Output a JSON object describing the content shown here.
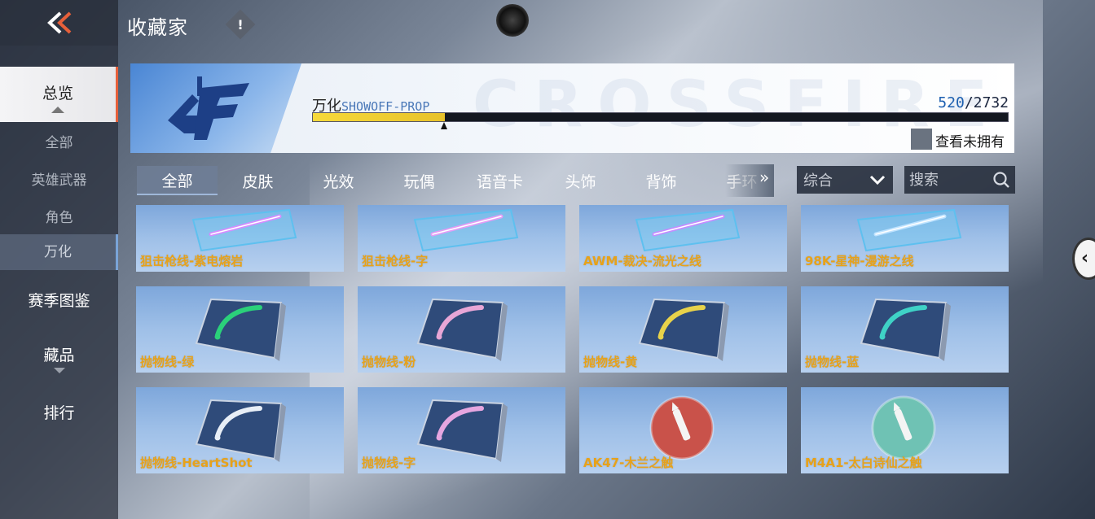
{
  "header": {
    "title": "收藏家",
    "info_glyph": "!"
  },
  "sidebar": {
    "items": [
      {
        "label": "总览"
      },
      {
        "label": "全部"
      },
      {
        "label": "英雄武器"
      },
      {
        "label": "角色"
      },
      {
        "label": "万化"
      },
      {
        "label": "赛季图鉴"
      },
      {
        "label": "藏品"
      },
      {
        "label": "排行"
      }
    ]
  },
  "banner": {
    "name": "万化",
    "sub": "SHOWOFF-PROP",
    "watermark": "CROSSFIRE",
    "count_current": "520",
    "count_total": "/2732",
    "progress_fraction": 0.19,
    "toggle_label": "查看未拥有"
  },
  "tabs": [
    {
      "label": "全部"
    },
    {
      "label": "皮肤"
    },
    {
      "label": "光效"
    },
    {
      "label": "玩偶"
    },
    {
      "label": "语音卡"
    },
    {
      "label": "头饰"
    },
    {
      "label": "背饰"
    },
    {
      "label": "手环"
    }
  ],
  "tabs_more": "»",
  "sort": {
    "value": "综合"
  },
  "search": {
    "placeholder": "搜索"
  },
  "items": [
    {
      "label": "狙击枪线-紫电熔岩",
      "kind": "laser",
      "color": "#d58cff"
    },
    {
      "label": "狙击枪线-字",
      "kind": "laser",
      "color": "#e39cf5"
    },
    {
      "label": "AWM-裁决-流光之线",
      "kind": "laser",
      "color": "#c48cff"
    },
    {
      "label": "98K-星神-漫游之线",
      "kind": "laser",
      "color": "#bfe3ff"
    },
    {
      "label": "抛物线-绿",
      "kind": "arc",
      "color": "#2bd17a"
    },
    {
      "label": "抛物线-粉",
      "kind": "arc",
      "color": "#e8a6d6"
    },
    {
      "label": "抛物线-黄",
      "kind": "arc",
      "color": "#e8d24a"
    },
    {
      "label": "抛物线-蓝",
      "kind": "arc",
      "color": "#3fd2c6"
    },
    {
      "label": "抛物线-HeartShot",
      "kind": "arc",
      "color": "#e8eef6"
    },
    {
      "label": "抛物线-字",
      "kind": "arc",
      "color": "#e6a6e0"
    },
    {
      "label": "AK47-木兰之触",
      "kind": "badge",
      "color": "#c9524a"
    },
    {
      "label": "M4A1-太白诗仙之触",
      "kind": "badge",
      "color": "#6fc2b4"
    }
  ]
}
